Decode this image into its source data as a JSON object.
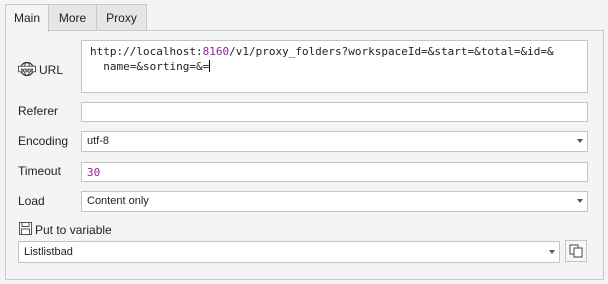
{
  "tabs": [
    {
      "label": "Main",
      "active": true
    },
    {
      "label": "More",
      "active": false
    },
    {
      "label": "Proxy",
      "active": false
    }
  ],
  "url": {
    "label": "URL",
    "icon": "www-globe-icon",
    "value_part1": "http://localhost:",
    "value_port": "8160",
    "value_part2": "/v1/proxy_folders?workspaceId=&start=&total=&id=&",
    "value_line2": "  name=&sorting=&="
  },
  "referer": {
    "label": "Referer",
    "value": ""
  },
  "encoding": {
    "label": "Encoding",
    "value": "utf-8"
  },
  "timeout": {
    "label": "Timeout",
    "value": "30",
    "value_color": "#9b1e9b"
  },
  "load": {
    "label": "Load",
    "value": "Content only"
  },
  "put_to_variable": {
    "label": "Put to variable",
    "icon": "save-icon",
    "value": "Listlistbad",
    "copy_icon": "copy-icon"
  }
}
